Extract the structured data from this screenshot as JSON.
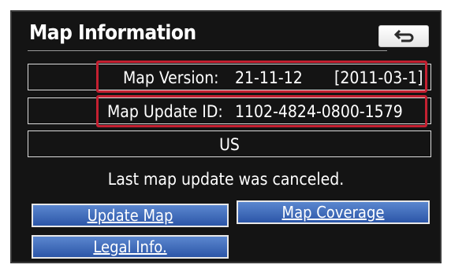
{
  "header": {
    "title": "Map Information",
    "back_icon": "back-arrow-icon"
  },
  "info": {
    "map_version_label": "Map Version:",
    "map_version_value": "21-11-12",
    "map_version_date": "[2011-03-1]",
    "update_id_label": "Map Update ID:",
    "update_id_value": "1102-4824-0800-1579",
    "region": "US"
  },
  "status_message": "Last map update was canceled.",
  "buttons": {
    "update_map": "Update Map",
    "map_coverage": "Map Coverage",
    "legal_info": "Legal Info."
  },
  "colors": {
    "screen_bg": "#141414",
    "highlight": "#c42031",
    "button": "#3f6bbd"
  }
}
